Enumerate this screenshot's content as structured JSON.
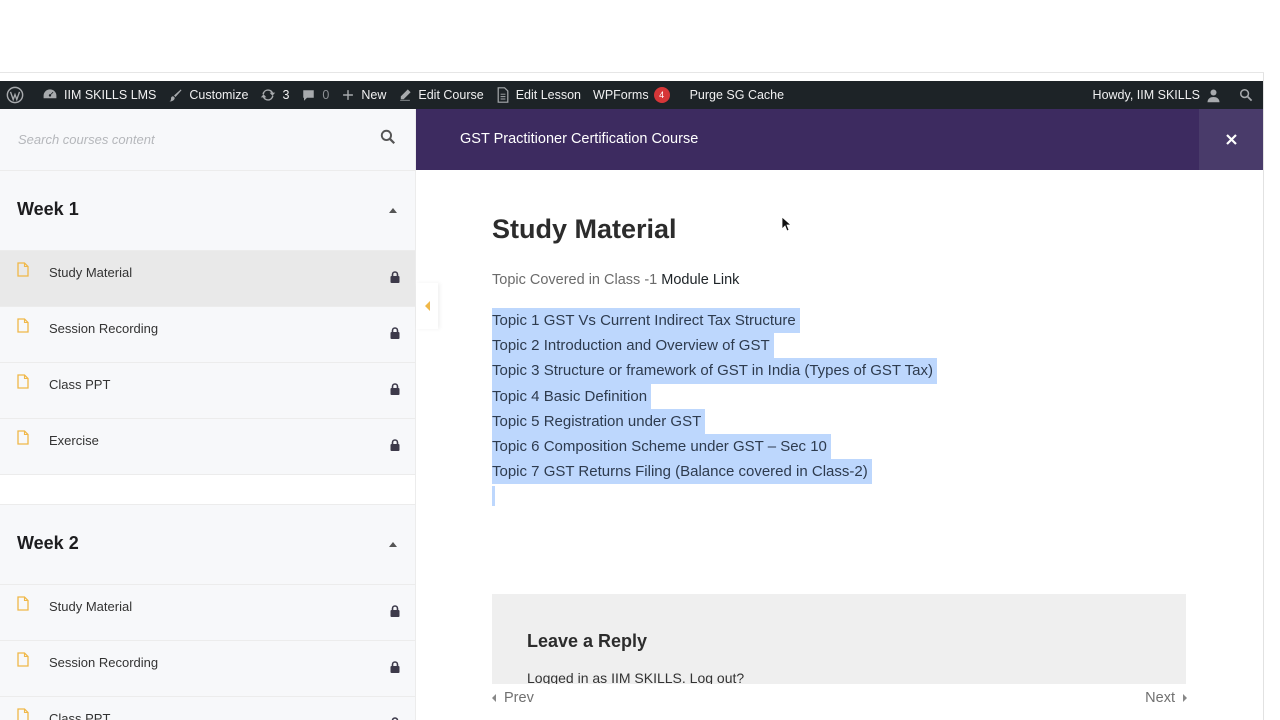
{
  "adminbar": {
    "site_name": "IIM SKILLS LMS",
    "customize": "Customize",
    "updates_count": "3",
    "comments_count": "0",
    "new_label": "New",
    "edit_course": "Edit Course",
    "edit_lesson": "Edit Lesson",
    "wpforms": "WPForms",
    "wpforms_badge": "4",
    "purge_cache": "Purge SG Cache",
    "howdy": "Howdy, IIM SKILLS"
  },
  "sidebar": {
    "search_placeholder": "Search courses content",
    "sections": [
      {
        "title": "Week 1",
        "lessons": [
          {
            "label": "Study Material",
            "locked": true,
            "active": true
          },
          {
            "label": "Session Recording",
            "locked": true
          },
          {
            "label": "Class PPT",
            "locked": true
          },
          {
            "label": "Exercise",
            "locked": true
          }
        ]
      },
      {
        "title": "Week 2",
        "lessons": [
          {
            "label": "Study Material",
            "locked": true
          },
          {
            "label": "Session Recording",
            "locked": true
          },
          {
            "label": "Class PPT",
            "locked": true
          }
        ]
      }
    ]
  },
  "course": {
    "title": "GST Practitioner Certification Course",
    "close_symbol": "×"
  },
  "lesson": {
    "title": "Study Material",
    "topic_prefix": "Topic Covered in Class -1",
    "topic_link": "Module Link",
    "topics": [
      "Topic 1 GST Vs Current Indirect Tax Structure",
      "Topic 2 Introduction and Overview of GST",
      "Topic 3 Structure or framework of GST in India (Types of GST Tax)",
      "Topic 4 Basic Definition",
      "Topic 5 Registration under GST",
      "Topic 6 Composition Scheme under GST – Sec 10",
      "Topic 7 GST Returns Filing (Balance covered in Class-2)"
    ]
  },
  "reply": {
    "title": "Leave a Reply",
    "logged_in": "Logged in as IIM SKILLS. Log out?"
  },
  "footer": {
    "prev": "Prev",
    "next": "Next"
  },
  "colors": {
    "adminbar": "#1d2327",
    "course_bar": "#3d2b60",
    "accent_yellow": "#f0b849",
    "selection": "#bdd7fd"
  }
}
